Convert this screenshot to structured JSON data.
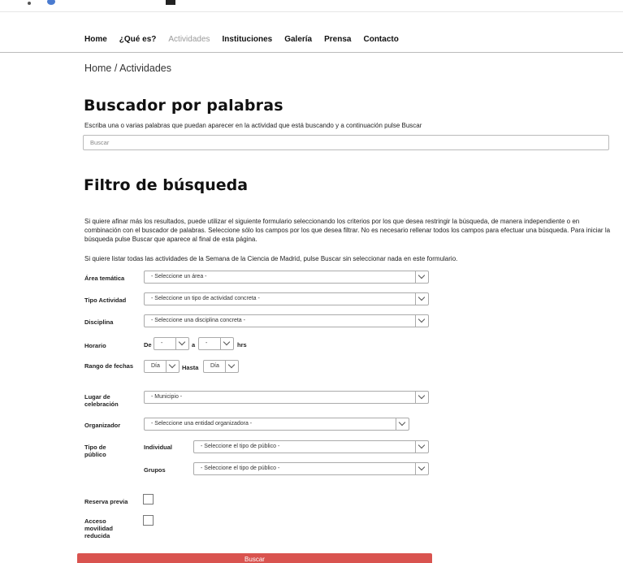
{
  "nav": {
    "items": [
      "Home",
      "¿Qué es?",
      "Actividades",
      "Instituciones",
      "Galería",
      "Prensa",
      "Contacto"
    ],
    "active": "Actividades"
  },
  "breadcrumb": "Home / Actividades",
  "search_section": {
    "title": "Buscador por palabras",
    "description": "Escriba una o varias palabras que puedan aparecer en la actividad que está buscando y a continuación pulse Buscar",
    "placeholder": "Buscar",
    "value": ""
  },
  "filter_section": {
    "title": "Filtro de búsqueda",
    "intro": "Si quiere afinar más los resultados, puede utilizar el siguiente formulario seleccionando los criterios por los que desea restringir la búsqueda, de manera independiente o en combinación con el buscador de palabras. Seleccione sólo los campos por los que desea filtrar. No es necesario rellenar todos los campos para efectuar una búsqueda. Para iniciar la búsqueda pulse Buscar que aparece al final de esta página.",
    "list_all": "Si quiere listar todas las actividades de la Semana de la Ciencia de Madrid, pulse Buscar sin seleccionar nada en este formulario."
  },
  "form": {
    "area": {
      "label": "Área temática",
      "value": "- Seleccione un área -"
    },
    "tipo_actividad": {
      "label": "Tipo Actividad",
      "value": "- Seleccione un tipo de actividad concreta -"
    },
    "disciplina": {
      "label": "Disciplina",
      "value": "- Seleccione una disciplina concreta -"
    },
    "horario": {
      "label": "Horario",
      "de": "De",
      "a": "a",
      "hrs": "hrs",
      "from_value": "-",
      "to_value": "-"
    },
    "rango": {
      "label": "Rango de fechas",
      "from_value": "Día",
      "hasta": "Hasta",
      "to_value": "Día"
    },
    "lugar": {
      "label": "Lugar de celebración",
      "value": "- Municipio -"
    },
    "organizador": {
      "label": "Organizador",
      "value": "- Seleccione una entidad organizadora -"
    },
    "publico": {
      "label": "Tipo de público",
      "individual_label": "Individual",
      "individual_value": "- Seleccione el tipo de público -",
      "grupos_label": "Grupos",
      "grupos_value": "- Seleccione el tipo de público -"
    },
    "reserva": {
      "label": "Reserva previa",
      "checked": false
    },
    "movilidad": {
      "label": "Acceso movilidad reducida",
      "checked": false
    }
  },
  "submit_label": "Buscar",
  "colors": {
    "submit": "#d9534f",
    "nav_inactive": "#9a9a9a"
  }
}
